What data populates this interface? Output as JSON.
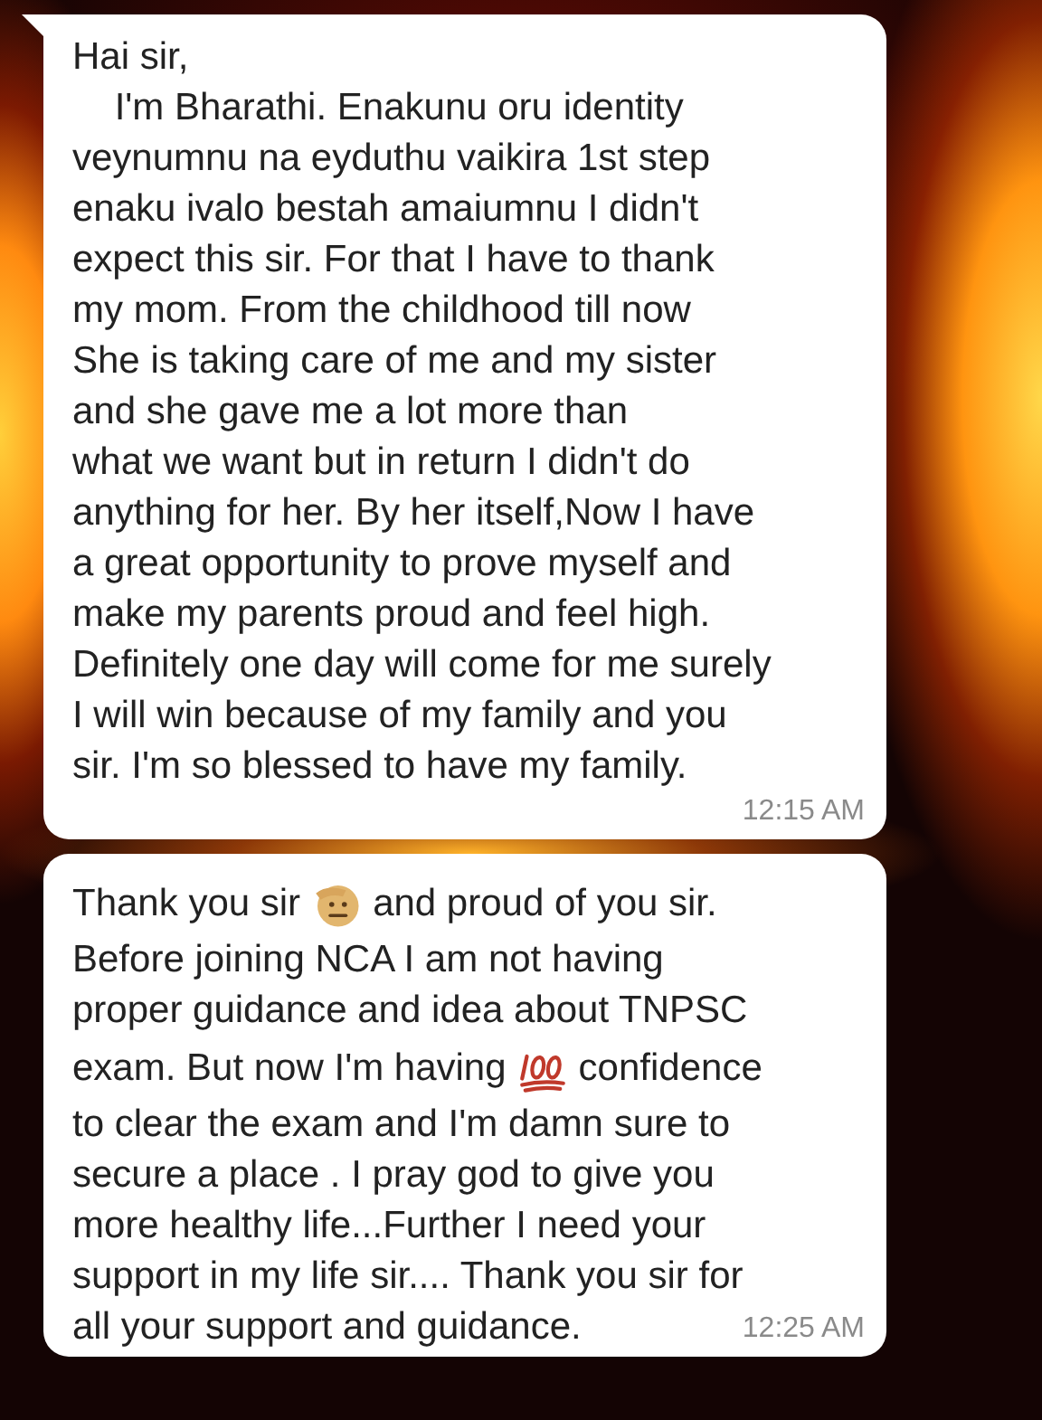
{
  "messages": [
    {
      "lines": [
        [
          {
            "kind": "text",
            "text": "Hai sir,"
          }
        ],
        [
          {
            "kind": "text",
            "text": "    I'm Bharathi. Enakunu oru identity"
          }
        ],
        [
          {
            "kind": "text",
            "text": "veynumnu na eyduthu vaikira 1st step"
          }
        ],
        [
          {
            "kind": "text",
            "text": "enaku ivalo bestah amaiumnu I didn't"
          }
        ],
        [
          {
            "kind": "text",
            "text": "expect this sir. For that I have to thank"
          }
        ],
        [
          {
            "kind": "text",
            "text": "my mom. From the childhood till now"
          }
        ],
        [
          {
            "kind": "text",
            "text": "She is taking care of me and my sister"
          }
        ],
        [
          {
            "kind": "text",
            "text": "and she gave me a lot more than"
          }
        ],
        [
          {
            "kind": "text",
            "text": "what we want but in return I didn't do"
          }
        ],
        [
          {
            "kind": "text",
            "text": "anything for her. By her itself,Now I have"
          }
        ],
        [
          {
            "kind": "text",
            "text": "a great opportunity to prove myself and"
          }
        ],
        [
          {
            "kind": "text",
            "text": "make my parents proud and feel high."
          }
        ],
        [
          {
            "kind": "text",
            "text": "Definitely one day will come for me surely"
          }
        ],
        [
          {
            "kind": "text",
            "text": "I will win because of my family and you"
          }
        ],
        [
          {
            "kind": "text",
            "text": "sir. I'm so blessed to have my family."
          }
        ]
      ],
      "time": "12:15 AM",
      "tail": true
    },
    {
      "lines": [
        [
          {
            "kind": "text",
            "text": "Thank you sir"
          },
          {
            "kind": "salute"
          },
          {
            "kind": "text",
            "text": "and proud of you sir."
          }
        ],
        [
          {
            "kind": "text",
            "text": "Before joining NCA I am not having"
          }
        ],
        [
          {
            "kind": "text",
            "text": "proper guidance and idea about TNPSC"
          }
        ],
        [
          {
            "kind": "text",
            "text": "exam. But now I'm having"
          },
          {
            "kind": "hundred"
          },
          {
            "kind": "text",
            "text": "confidence"
          }
        ],
        [
          {
            "kind": "text",
            "text": "to clear the exam and I'm damn sure to"
          }
        ],
        [
          {
            "kind": "text",
            "text": "secure a place . I pray god to give you"
          }
        ],
        [
          {
            "kind": "text",
            "text": "more healthy life...Further I need your"
          }
        ],
        [
          {
            "kind": "text",
            "text": "support in my life sir.... Thank you sir for"
          }
        ],
        [
          {
            "kind": "text",
            "text": "all your support and guidance."
          }
        ]
      ],
      "time": "12:25 AM",
      "tail": false
    }
  ]
}
